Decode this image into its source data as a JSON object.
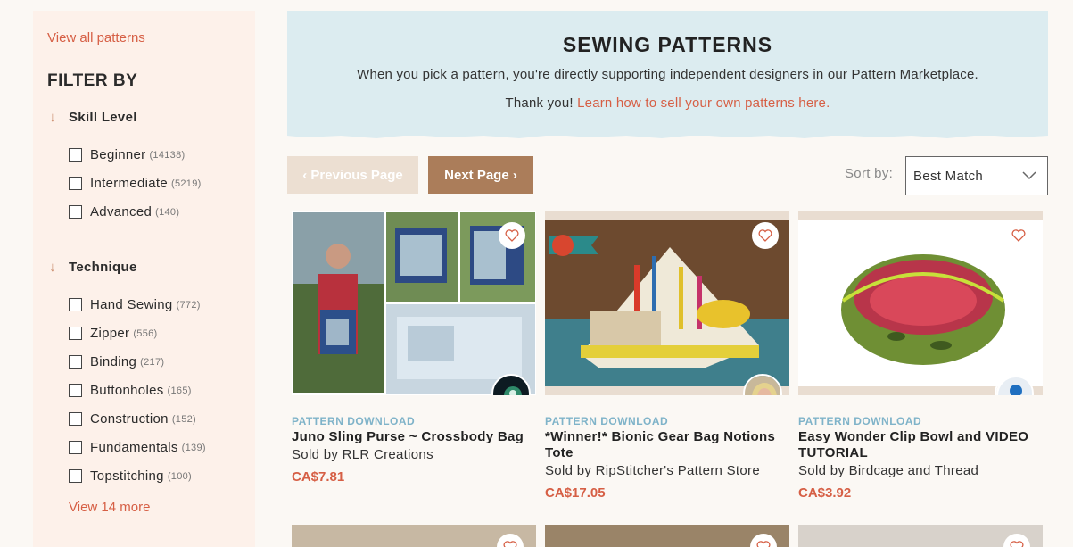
{
  "sidebar": {
    "view_all": "View all patterns",
    "filter_title": "FILTER BY",
    "skill_level": {
      "label": "Skill Level",
      "options": [
        {
          "label": "Beginner",
          "count": "(14138)"
        },
        {
          "label": "Intermediate",
          "count": "(5219)"
        },
        {
          "label": "Advanced",
          "count": "(140)"
        }
      ]
    },
    "technique": {
      "label": "Technique",
      "options": [
        {
          "label": "Hand Sewing",
          "count": "(772)"
        },
        {
          "label": "Zipper",
          "count": "(556)"
        },
        {
          "label": "Binding",
          "count": "(217)"
        },
        {
          "label": "Buttonholes",
          "count": "(165)"
        },
        {
          "label": "Construction",
          "count": "(152)"
        },
        {
          "label": "Fundamentals",
          "count": "(139)"
        },
        {
          "label": "Topstitching",
          "count": "(100)"
        }
      ],
      "more": "View 14 more"
    }
  },
  "banner": {
    "title": "SEWING PATTERNS",
    "line1": "When you pick a pattern, you're directly supporting independent designers in our Pattern Marketplace.",
    "line2": "Thank you!",
    "link": "Learn how to sell your own patterns here."
  },
  "pager": {
    "prev": "‹ Previous Page",
    "next": "Next Page ›",
    "sort_label": "Sort by:",
    "sort_value": "Best Match"
  },
  "products": [
    {
      "kind": "PATTERN DOWNLOAD",
      "title": "Juno Sling Purse ~ Crossbody Bag",
      "seller": "Sold by RLR Creations",
      "price": "CA$7.81"
    },
    {
      "kind": "PATTERN DOWNLOAD",
      "title": "*Winner!* Bionic Gear Bag Notions Tote",
      "seller": "Sold by RipStitcher's Pattern Store",
      "price": "CA$17.05"
    },
    {
      "kind": "PATTERN DOWNLOAD",
      "title": "Easy Wonder Clip Bowl and VIDEO TUTORIAL",
      "seller": "Sold by Birdcage and Thread",
      "price": "CA$3.92"
    }
  ],
  "colors": {
    "accent": "#d65f45",
    "next_button": "#ab7d5a",
    "prev_button": "#ecdfd2",
    "banner_bg": "#dcecf0",
    "kind_label": "#7fb3c9"
  }
}
